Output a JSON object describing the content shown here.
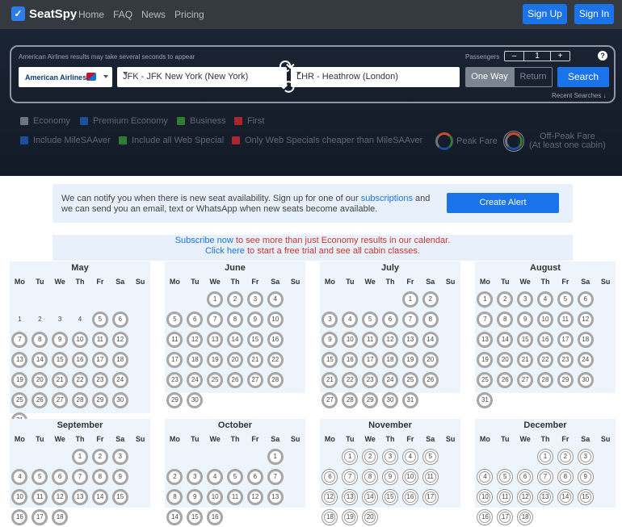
{
  "nav": {
    "brand": "SeatSpy",
    "links": [
      "Home",
      "FAQ",
      "News",
      "Pricing"
    ],
    "signup": "Sign Up",
    "signin": "Sign In"
  },
  "search": {
    "notice": "American Airlines results may take several seconds to appear",
    "passengers_label": "Passengers",
    "passengers_minus": "–",
    "passengers_value": "1",
    "passengers_plus": "+",
    "help": "?",
    "airline": "American Airlines",
    "origin": "JFK - JFK New York (New York)",
    "destination": "LHR - Heathrow (London)",
    "oneway": "One Way",
    "return": "Return",
    "button": "Search",
    "recent": "Recent Searches ↓"
  },
  "filters": {
    "economy": "Economy",
    "premium": "Premium Economy",
    "business": "Business",
    "first": "First",
    "include_milesaaver": "Include MileSAAver",
    "include_web": "Include all Web Special",
    "only_web": "Only Web Specials cheaper than MileSAAver",
    "peak": "Peak Fare",
    "offpeak_line1": "Off-Peak Fare",
    "offpeak_line2": "(At least one cabin)"
  },
  "colors": {
    "accent": "#1a73e8",
    "topbar": "#343a40",
    "hero": "#1b2433",
    "economy": "#6c757d",
    "premium": "#1a4f9c",
    "business": "#2e7d32",
    "first": "#a8262c"
  },
  "alert": {
    "text_a": "We can notify you when there is new seat availability. Sign up for one of our ",
    "link": "subscriptions",
    "text_b": " and we can send you an email, text or WhatsApp when new seats become available.",
    "button": "Create Alert"
  },
  "subscribe": {
    "link1": "Subscribe now",
    "text1": " to see more than just Economy results in our calendar.",
    "link2": "Click here",
    "text2": " to start a free trial and see all cabin classes."
  },
  "weekdays": [
    "Mo",
    "Tu",
    "We",
    "Th",
    "Fr",
    "Sa",
    "Su"
  ],
  "months": [
    {
      "name": "May",
      "offset": 6,
      "days": 31,
      "available_from": 5
    },
    {
      "name": "June",
      "offset": 2,
      "days": 30,
      "available_from": 1
    },
    {
      "name": "July",
      "offset": 4,
      "days": 31,
      "available_from": 1
    },
    {
      "name": "August",
      "offset": 0,
      "days": 31,
      "available_from": 1
    },
    {
      "name": "September",
      "offset": 3,
      "days": 18,
      "available_from": 1
    },
    {
      "name": "October",
      "offset": 5,
      "days": 16,
      "available_from": 1
    },
    {
      "name": "November",
      "offset": 1,
      "days": 20,
      "available_from": 1
    },
    {
      "name": "December",
      "offset": 3,
      "days": 18,
      "available_from": 1
    }
  ]
}
